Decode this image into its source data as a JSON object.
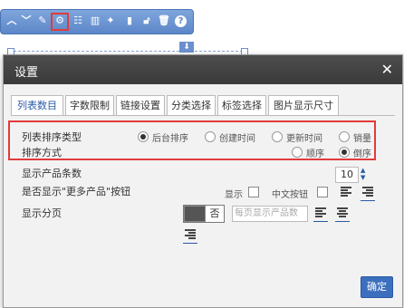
{
  "toolbar": {
    "icons": [
      "arrow-up-icon",
      "arrow-down-icon",
      "edit-icon",
      "settings-icon",
      "list-icon",
      "column-icon",
      "magic-wand-icon",
      "chart-icon",
      "lock-icon",
      "delete-icon",
      "help-icon"
    ],
    "help_glyph": "?"
  },
  "dialog": {
    "title": "设置",
    "close_glyph": "✕",
    "tabs": [
      "列表数目",
      "字数限制",
      "链接设置",
      "分类选择",
      "标签选择",
      "图片显示尺寸"
    ],
    "active_tab": 0,
    "sort_type_label": "列表排序类型",
    "sort_type_options": [
      "后台排序",
      "创建时间",
      "更新时间",
      "销量"
    ],
    "sort_type_selected": 0,
    "sort_order_label": "排序方式",
    "sort_order_options": [
      "顺序",
      "倒序"
    ],
    "sort_order_selected": 1,
    "product_count_label": "显示产品条数",
    "product_count_value": "10",
    "more_button_label": "是否显示\"更多产品\"按钮",
    "show_label": "显示",
    "chinese_button_label": "中文按钮",
    "pagination_label": "显示分页",
    "pagination_toggle_value": "否",
    "per_page_placeholder": "每页显示产品数",
    "ok_label": "确定"
  }
}
